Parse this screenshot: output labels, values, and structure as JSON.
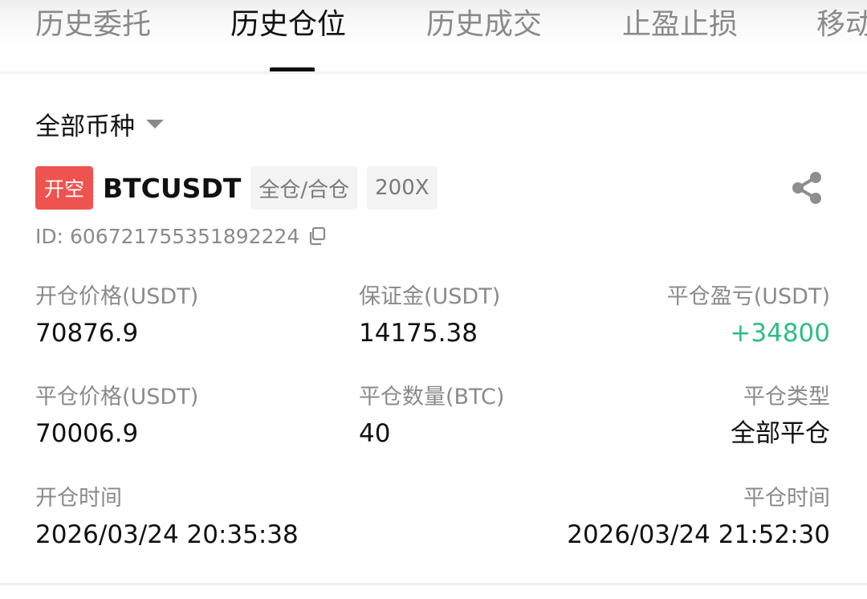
{
  "tabs": [
    {
      "label": "历史委托"
    },
    {
      "label": "历史仓位"
    },
    {
      "label": "历史成交"
    },
    {
      "label": "止盈止损"
    },
    {
      "label": "移动"
    }
  ],
  "filter": {
    "label": "全部币种"
  },
  "position": {
    "side": "开空",
    "symbol": "BTCUSDT",
    "margin_mode": "全仓/合仓",
    "leverage": "200X",
    "id": "ID: 606721755351892224",
    "colors": {
      "side_bg": "#ef5350",
      "pnl_positive": "#2ebd85"
    },
    "fields": {
      "open_price_label": "开仓价格(USDT)",
      "open_price": "70876.9",
      "margin_label": "保证金(USDT)",
      "margin": "14175.38",
      "pnl_label": "平仓盈亏(USDT)",
      "pnl": "+34800",
      "close_price_label": "平仓价格(USDT)",
      "close_price": "70006.9",
      "close_qty_label": "平仓数量(BTC)",
      "close_qty": "40",
      "close_type_label": "平仓类型",
      "close_type": "全部平仓",
      "open_time_label": "开仓时间",
      "open_time": "2026/03/24 20:35:38",
      "close_time_label": "平仓时间",
      "close_time": "2026/03/24 21:52:30"
    }
  },
  "icons": {
    "share": "share-icon",
    "copy": "copy-icon",
    "caret": "caret-down-icon"
  }
}
